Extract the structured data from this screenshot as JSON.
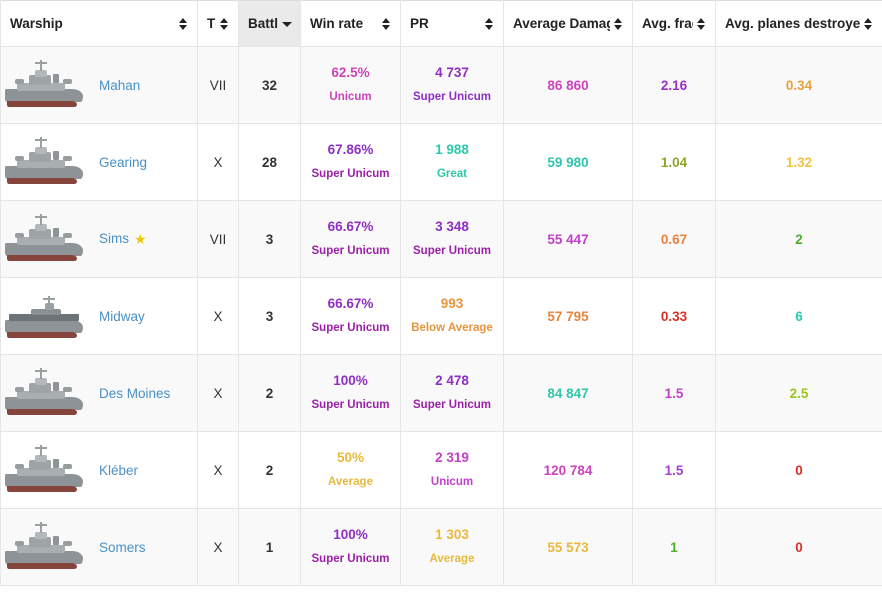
{
  "table": {
    "columns": [
      {
        "label": "Warship",
        "key": "warship",
        "sortable": true,
        "sorted": false,
        "align": "left"
      },
      {
        "label": "Tier",
        "key": "tier",
        "sortable": true,
        "sorted": false,
        "align": "center"
      },
      {
        "label": "Battles",
        "key": "battles",
        "sortable": true,
        "sorted": true,
        "sort_dir": "desc",
        "align": "center"
      },
      {
        "label": "Win rate",
        "key": "winrate",
        "sortable": true,
        "sorted": false,
        "align": "center"
      },
      {
        "label": "PR",
        "key": "pr",
        "sortable": true,
        "sorted": false,
        "align": "center"
      },
      {
        "label": "Average Damage",
        "key": "avgdmg",
        "sortable": true,
        "sorted": false,
        "align": "center"
      },
      {
        "label": "Avg. frags",
        "key": "avgfrags",
        "sortable": true,
        "sorted": false,
        "align": "center"
      },
      {
        "label": "Avg. planes destroyed",
        "key": "avgplanes",
        "sortable": true,
        "sorted": false,
        "align": "center"
      }
    ],
    "rows": [
      {
        "ship": "Mahan",
        "ship_type": "destroyer",
        "featured": false,
        "star_icon": "",
        "tier": "VII",
        "battles": "32",
        "winrate": "62.5%",
        "winrate_rating": "Unicum",
        "winrate_color": "#cc44bb",
        "winrate_rating_color": "#cc44bb",
        "pr": "4 737",
        "pr_rating": "Super Unicum",
        "pr_color": "#8e2ec2",
        "pr_rating_color": "#8e2ec2",
        "avgdmg": "86 860",
        "avgdmg_color": "#cc44bb",
        "avgfrags": "2.16",
        "avgfrags_color": "#9b30c4",
        "avgplanes": "0.34",
        "avgplanes_color": "#e8a33d"
      },
      {
        "ship": "Gearing",
        "ship_type": "destroyer",
        "featured": false,
        "star_icon": "",
        "tier": "X",
        "battles": "28",
        "winrate": "67.86%",
        "winrate_rating": "Super Unicum",
        "winrate_color": "#8e2ec2",
        "winrate_rating_color": "#9b1fa8",
        "pr": "1 988",
        "pr_rating": "Great",
        "pr_color": "#2fc7ab",
        "pr_rating_color": "#2fc7ab",
        "avgdmg": "59 980",
        "avgdmg_color": "#2fc7ab",
        "avgfrags": "1.04",
        "avgfrags_color": "#88a72a",
        "avgplanes": "1.32",
        "avgplanes_color": "#f2c33c"
      },
      {
        "ship": "Sims",
        "ship_type": "destroyer",
        "featured": true,
        "star_icon": "★",
        "tier": "VII",
        "battles": "3",
        "winrate": "66.67%",
        "winrate_rating": "Super Unicum",
        "winrate_color": "#8e2ec2",
        "winrate_rating_color": "#9b1fa8",
        "pr": "3 348",
        "pr_rating": "Super Unicum",
        "pr_color": "#8e2ec2",
        "pr_rating_color": "#9b1fa8",
        "avgdmg": "55 447",
        "avgdmg_color": "#c040c9",
        "avgfrags": "0.67",
        "avgfrags_color": "#e8823d",
        "avgplanes": "2",
        "avgplanes_color": "#4caf26"
      },
      {
        "ship": "Midway",
        "ship_type": "carrier",
        "featured": false,
        "star_icon": "",
        "tier": "X",
        "battles": "3",
        "winrate": "66.67%",
        "winrate_rating": "Super Unicum",
        "winrate_color": "#8e2ec2",
        "winrate_rating_color": "#9b1fa8",
        "pr": "993",
        "pr_rating": "Below Average",
        "pr_color": "#e8953d",
        "pr_rating_color": "#e8953d",
        "avgdmg": "57 795",
        "avgdmg_color": "#e8853d",
        "avgfrags": "0.33",
        "avgfrags_color": "#d93025",
        "avgplanes": "6",
        "avgplanes_color": "#2fc7ab"
      },
      {
        "ship": "Des Moines",
        "ship_type": "cruiser",
        "featured": false,
        "star_icon": "",
        "tier": "X",
        "battles": "2",
        "winrate": "100%",
        "winrate_rating": "Super Unicum",
        "winrate_color": "#8e2ec2",
        "winrate_rating_color": "#9b1fa8",
        "pr": "2 478",
        "pr_rating": "Super Unicum",
        "pr_color": "#8e2ec2",
        "pr_rating_color": "#9b1fa8",
        "avgdmg": "84 847",
        "avgdmg_color": "#2fc7ab",
        "avgfrags": "1.5",
        "avgfrags_color": "#c040c9",
        "avgplanes": "2.5",
        "avgplanes_color": "#9ac61c"
      },
      {
        "ship": "Kléber",
        "ship_type": "destroyer",
        "featured": false,
        "star_icon": "",
        "tier": "X",
        "battles": "2",
        "winrate": "50%",
        "winrate_rating": "Average",
        "winrate_color": "#e8b93d",
        "winrate_rating_color": "#e8b93d",
        "pr": "2 319",
        "pr_rating": "Unicum",
        "pr_color": "#c040c9",
        "pr_rating_color": "#c040c9",
        "avgdmg": "120 784",
        "avgdmg_color": "#cc44bb",
        "avgfrags": "1.5",
        "avgfrags_color": "#a63fd0",
        "avgplanes": "0",
        "avgplanes_color": "#d93025"
      },
      {
        "ship": "Somers",
        "ship_type": "destroyer",
        "featured": false,
        "star_icon": "",
        "tier": "X",
        "battles": "1",
        "winrate": "100%",
        "winrate_rating": "Super Unicum",
        "winrate_color": "#8e2ec2",
        "winrate_rating_color": "#9b1fa8",
        "pr": "1 303",
        "pr_rating": "Average",
        "pr_color": "#e8b93d",
        "pr_rating_color": "#e8b93d",
        "avgdmg": "55 573",
        "avgdmg_color": "#e8b93d",
        "avgfrags": "1",
        "avgfrags_color": "#4caf26",
        "avgplanes": "0",
        "avgplanes_color": "#d93025"
      }
    ]
  }
}
